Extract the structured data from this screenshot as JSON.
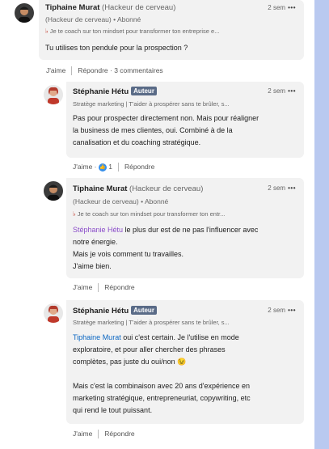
{
  "comments": [
    {
      "author": "Tiphaine Murat",
      "degree": "(Hackeur de cerveau)",
      "degree2": "(Hackeur de cerveau)",
      "follow": "Abonné",
      "headline": "Je te coach sur ton mindset pour transformer ton entreprise e...",
      "time": "2 sem",
      "text": "Tu utilises ton pendule pour la prospection ?",
      "actions": {
        "like": "J'aime",
        "reply": "Répondre",
        "count": "3 commentaires"
      }
    },
    {
      "author": "Stéphanie Hétu",
      "badge": "Auteur",
      "headline": "Stratège marketing | T'aider à prospérer sans te brûler, s...",
      "time": "2 sem",
      "lines": [
        "Pas pour prospecter directement non. Mais pour réaligner",
        "la business de mes clientes, oui. Combiné à de la",
        "canalisation et du coaching stratégique."
      ],
      "actions": {
        "like": "J'aime",
        "reactions": "1",
        "reply": "Répondre"
      }
    },
    {
      "author": "Tiphaine Murat",
      "degree": "(Hackeur de cerveau)",
      "degree2": "(Hackeur de cerveau)",
      "follow": "Abonné",
      "headline": "Je te coach sur ton mindset pour transformer ton entr...",
      "time": "2 sem",
      "mention": "Stéphanie Hétu",
      "line1_rest": " le plus dur est de ne pas l'influencer avec",
      "lines": [
        "notre énergie.",
        "Mais je vois comment tu travailles.",
        "J'aime bien."
      ],
      "actions": {
        "like": "J'aime",
        "reply": "Répondre"
      }
    },
    {
      "author": "Stéphanie Hétu",
      "badge": "Auteur",
      "headline": "Stratège marketing | T'aider à prospérer sans te brûler, s...",
      "time": "2 sem",
      "mention": "Tiphaine Murat",
      "line1_rest": " oui c'est certain. Je l'utilise en mode",
      "lines": [
        "exploratoire, et pour aller chercher des phrases",
        "complètes, pas juste du oui/non 😉",
        "",
        "Mais c'est la combinaison avec 20 ans d'expérience en",
        "marketing stratégique, entrepreneuriat, copywriting, etc",
        "qui rend le tout puissant."
      ],
      "actions": {
        "like": "J'aime",
        "reply": "Répondre"
      }
    }
  ],
  "icons": {
    "more": "more-dots-icon",
    "tie": "tie-icon",
    "reaction": "like-reaction-icon"
  },
  "colors": {
    "bubble": "#f2f2f2",
    "mention": "#0a66c2",
    "badge": "#5a6b87",
    "scrollbar": "#b9c9f0"
  }
}
